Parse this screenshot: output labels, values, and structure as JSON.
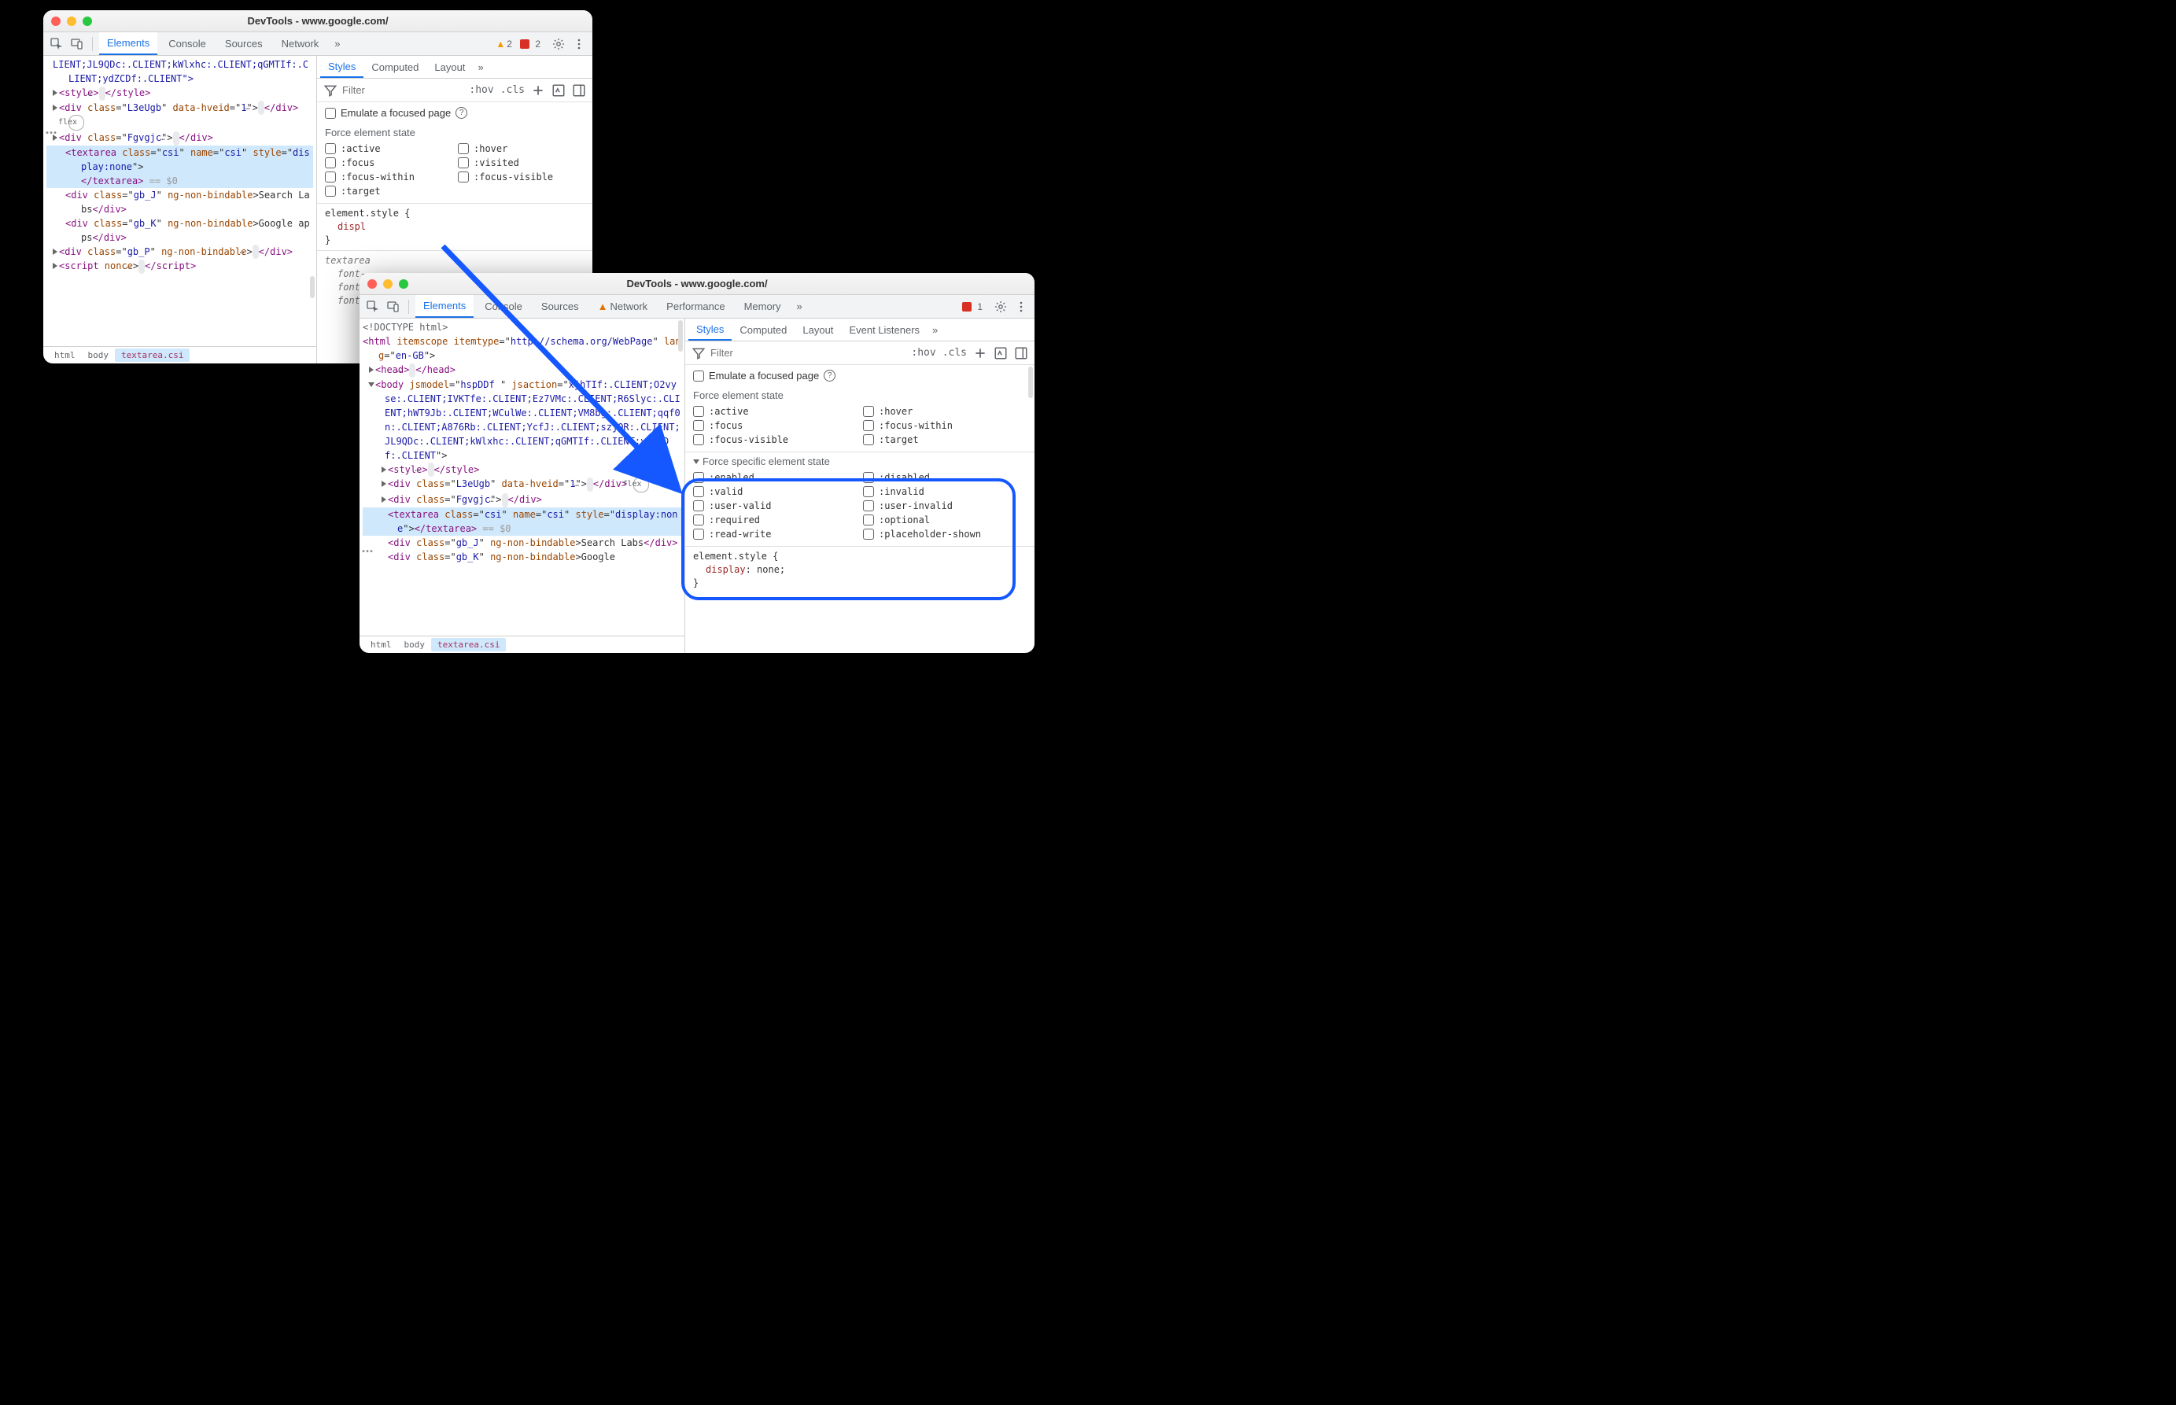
{
  "window1": {
    "title": "DevTools - www.google.com/",
    "tabs": [
      "Elements",
      "Console",
      "Sources",
      "Network"
    ],
    "counts": {
      "warn": "2",
      "err": "2"
    },
    "breadcrumb": [
      "html",
      "body",
      "textarea.csi"
    ],
    "dom": {
      "l0": "LIENT;JL9QDc:.CLIENT;kWlxhc:.CLIENT;qGMTIf:.CLIENT;ydZCDf:.CLIENT\">",
      "l1a": "<style>",
      "l1b": "</style>",
      "l2a": "<div ",
      "l2b": "class",
      "l2c": "=\"",
      "l2d": "L3eUgb",
      "l2e": "\" ",
      "l2f": "data-hveid",
      "l2g": "=\"",
      "l2h": "1",
      "l2i": "\">",
      "l2j": "</div>",
      "l2flex": "flex",
      "l3a": "<div ",
      "l3b": "class",
      "l3c": "=\"",
      "l3d": "Fgvgjc",
      "l3e": "\">",
      "l3f": "</div>",
      "l4a": "<textarea ",
      "l4b": "class",
      "l4c": "=\"",
      "l4d": "csi",
      "l4e": "\" ",
      "l4f": "name",
      "l4g": "=\"",
      "l4h": "csi",
      "l4i": "\" ",
      "l4j": "style",
      "l4k": "=\"",
      "l4l": "display:none",
      "l4m": "\">",
      "l5a": "</textarea>",
      "l5b": " == $0",
      "l6a": "<div ",
      "l6b": "class",
      "l6c": "=\"",
      "l6d": "gb_J",
      "l6e": "\" ",
      "l6f": "ng-non-bindable",
      "l6g": ">Search Labs",
      "l6h": "</div>",
      "l7a": "<div ",
      "l7b": "class",
      "l7c": "=\"",
      "l7d": "gb_K",
      "l7e": "\" ",
      "l7f": "ng-non-bindable",
      "l7g": ">Google apps",
      "l7h": "</div>",
      "l8a": "<div ",
      "l8b": "class",
      "l8c": "=\"",
      "l8d": "gb_P",
      "l8e": "\" ",
      "l8f": "ng-non-bindable",
      "l8g": ">",
      "l8h": "</div>",
      "l9a": "<script ",
      "l9b": "nonce",
      "l9c": ">",
      "l9d": "</script>"
    },
    "styles": {
      "tabs": [
        "Styles",
        "Computed",
        "Layout"
      ],
      "filter_placeholder": "Filter",
      "hov": ":hov",
      "cls": ".cls",
      "emulate": "Emulate a focused page",
      "force_title": "Force element state",
      "states_left": [
        ":active",
        ":focus",
        ":focus-within",
        ":target"
      ],
      "states_right": [
        ":hover",
        ":visited",
        ":focus-visible"
      ],
      "rule1_sel": "element.style {",
      "rule1_prop": "displ",
      "rule1_close": "}",
      "rule2_sel": "textarea",
      "rule2_p1": "font-",
      "rule2_p2": "font-",
      "rule2_p3": "font-"
    }
  },
  "window2": {
    "title": "DevTools - www.google.com/",
    "tabs": [
      "Elements",
      "Console",
      "Sources",
      "Network",
      "Performance",
      "Memory"
    ],
    "warn_tab_index": 3,
    "counts": {
      "err": "1"
    },
    "breadcrumb": [
      "html",
      "body",
      "textarea.csi"
    ],
    "dom": {
      "l0": "<!DOCTYPE html>",
      "l1a": "<html ",
      "l1b": "itemscope itemtype",
      "l1c": "=\"",
      "l1d": "http://schema.org/WebPage",
      "l1e": "\" ",
      "l1f": "lang",
      "l1g": "=\"",
      "l1h": "en-GB",
      "l1i": "\">",
      "l2a": "<head>",
      "l2b": "</head>",
      "l3a": "<body ",
      "l3b": "jsmodel",
      "l3c": "=\"",
      "l3d": "hspDDf ",
      "l3e": "\" ",
      "l3f": "jsaction",
      "l3g": "=\"",
      "l3h": "xjhTIf:.CLIENT;O2vyse:.CLIENT;IVKTfe:.CLIENT;Ez7VMc:.CLIENT;R6Slyc:.CLIENT;hWT9Jb:.CLIENT;WCulWe:.CLIENT;VM8bg:.CLIENT;qqf0n:.CLIENT;A876Rb:.CLIENT;YcfJ:.CLIENT;szjOR:.CLIENT;JL9QDc:.CLIENT;kWlxhc:.CLIENT;qGMTIf:.CLIENT;ydZCDf:.CLIENT",
      "l3i": "\">",
      "l4a": "<style>",
      "l4b": "</style>",
      "l5a": "<div ",
      "l5b": "class",
      "l5c": "=\"",
      "l5d": "L3eUgb",
      "l5e": "\" ",
      "l5f": "data-hveid",
      "l5g": "=\"",
      "l5h": "1",
      "l5i": "\">",
      "l5j": "</div>",
      "l5flex": "flex",
      "l6a": "<div ",
      "l6b": "class",
      "l6c": "=\"",
      "l6d": "Fgvgjc",
      "l6e": "\">",
      "l6f": "</div>",
      "l7a": "<textarea ",
      "l7b": "class",
      "l7c": "=\"",
      "l7d": "csi",
      "l7e": "\" ",
      "l7f": "name",
      "l7g": "=\"",
      "l7h": "csi",
      "l7i": "\" ",
      "l7j": "style",
      "l7k": "=\"",
      "l7l": "display:none",
      "l7m": "\">",
      "l7n": "</textarea>",
      "l7o": " == $0",
      "l8a": "<div ",
      "l8b": "class",
      "l8c": "=\"",
      "l8d": "gb_J",
      "l8e": "\" ",
      "l8f": "ng-non-bindable",
      "l8g": ">Search Labs",
      "l8h": "</div>",
      "l9a": "<div ",
      "l9b": "class",
      "l9c": "=\"",
      "l9d": "gb_K",
      "l9e": "\" ",
      "l9f": "ng-non-bindable",
      "l9g": ">Google"
    },
    "styles": {
      "tabs": [
        "Styles",
        "Computed",
        "Layout",
        "Event Listeners"
      ],
      "filter_placeholder": "Filter",
      "hov": ":hov",
      "cls": ".cls",
      "emulate": "Emulate a focused page",
      "force_title": "Force element state",
      "states_left": [
        ":active",
        ":focus",
        ":focus-visible"
      ],
      "states_right": [
        ":hover",
        ":focus-within",
        ":target"
      ],
      "specific_title": "Force specific element state",
      "spec_left": [
        ":enabled",
        ":valid",
        ":user-valid",
        ":required",
        ":read-write"
      ],
      "spec_right": [
        ":disabled",
        ":invalid",
        ":user-invalid",
        ":optional",
        ":placeholder-shown"
      ],
      "rule1_sel": "element.style {",
      "rule1_prop": "display",
      "rule1_val": ": none;",
      "rule1_close": "}"
    }
  }
}
